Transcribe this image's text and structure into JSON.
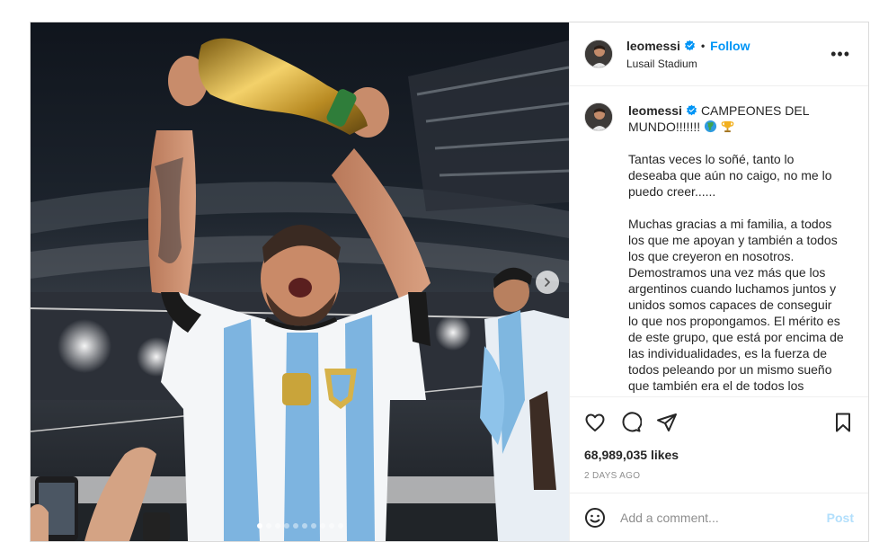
{
  "post": {
    "username": "leomessi",
    "follow_label": "Follow",
    "separator": "•",
    "location": "Lusail Stadium",
    "more_label": "•••"
  },
  "caption": {
    "username": "leomessi",
    "title": "CAMPEONES DEL MUNDO!!!!!!! ",
    "paragraphs": [
      "Tantas veces lo soñé, tanto lo deseaba que aún no caigo, no me lo puedo creer......",
      "Muchas gracias a mi familia, a todos los que me apoyan y también a todos los que creyeron en nosotros. Demostramos una vez más que los argentinos cuando luchamos juntos y unidos somos capaces de conseguir lo que nos propongamos. El mérito es de este grupo, que está por encima de las individualidades, es la fuerza de todos peleando por un mismo sueño que también era el de todos los"
    ]
  },
  "engagement": {
    "likes": "68,989,035 likes",
    "time": "2 DAYS AGO"
  },
  "composer": {
    "placeholder": "Add a comment...",
    "post_label": "Post"
  },
  "carousel": {
    "slides": 10,
    "active": 0
  },
  "colors": {
    "accent": "#0095f6",
    "post_disabled": "#b2dffc",
    "muted": "#8e8e8e",
    "border": "#dbdbdb"
  },
  "icons": [
    "verified-badge-icon",
    "more-options-icon",
    "heart-icon",
    "comment-icon",
    "share-icon",
    "bookmark-icon",
    "emoji-icon",
    "chevron-right-icon",
    "globe-emoji-icon",
    "trophy-emoji-icon"
  ]
}
